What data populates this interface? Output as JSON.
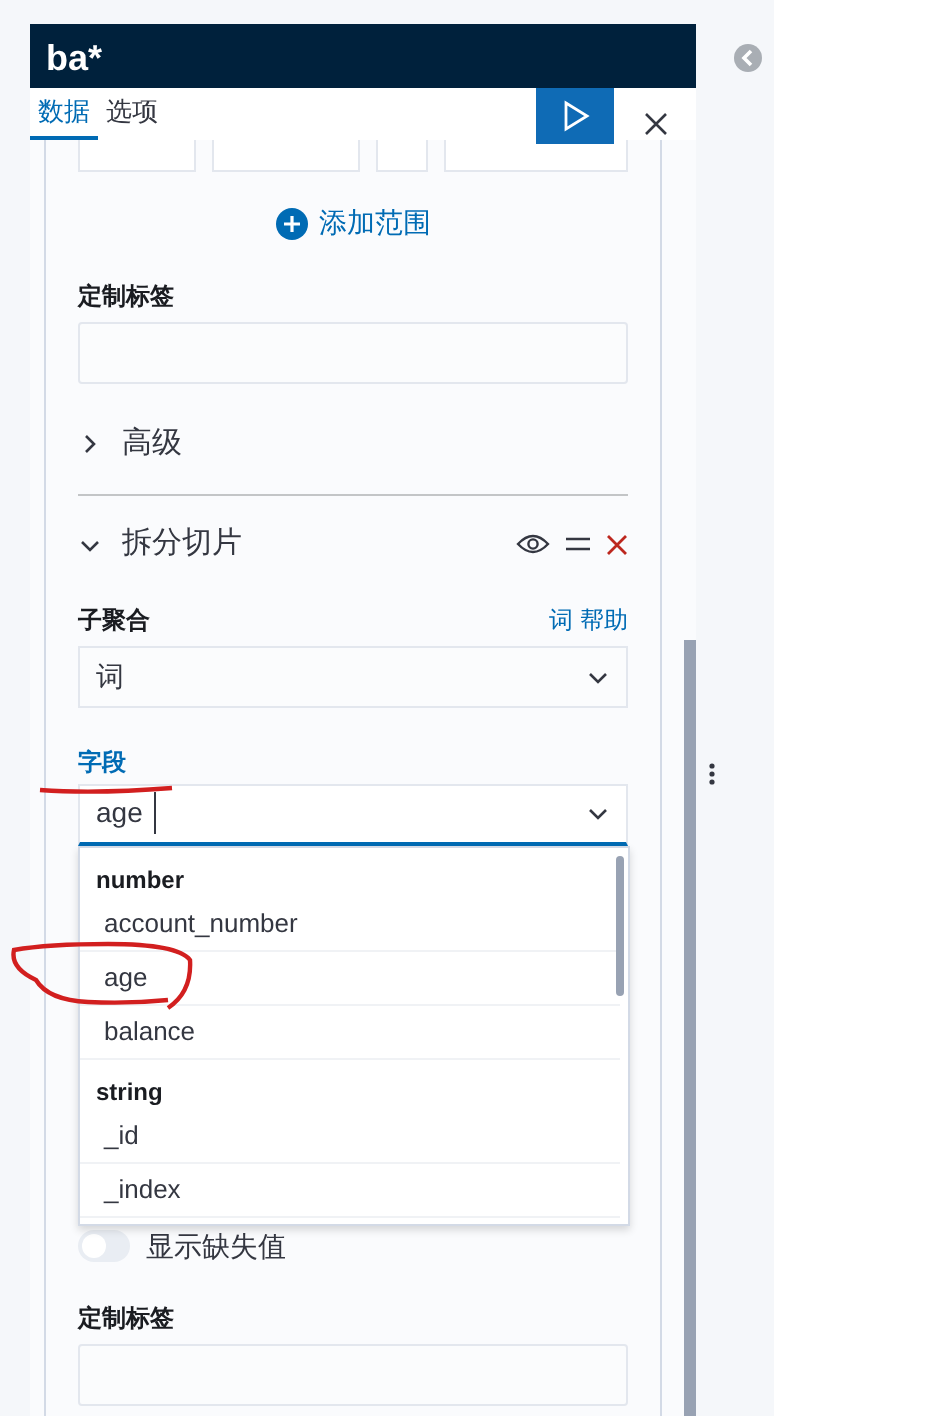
{
  "panel": {
    "title": "ba*",
    "tabs": [
      {
        "label": "数据",
        "selected": true
      },
      {
        "label": "选项",
        "selected": false
      }
    ]
  },
  "range": {
    "add_label": "添加范围"
  },
  "custom_label_top": {
    "label": "定制标签"
  },
  "advanced": {
    "label": "高级",
    "expanded": false
  },
  "split": {
    "label": "拆分切片",
    "expanded": true,
    "sub_agg_label": "子聚合",
    "help_link": "词 帮助",
    "sub_agg_value": "词",
    "field_label": "字段",
    "field_value": "age",
    "options": [
      {
        "kind": "group",
        "label": "number"
      },
      {
        "kind": "option",
        "label": "account_number"
      },
      {
        "kind": "option",
        "label": "age"
      },
      {
        "kind": "option",
        "label": "balance"
      },
      {
        "kind": "group",
        "label": "string"
      },
      {
        "kind": "option",
        "label": "_id"
      },
      {
        "kind": "option",
        "label": "_index"
      }
    ],
    "missing_toggle": {
      "label": "显示缺失值",
      "on": false
    },
    "custom_label": "定制标签"
  }
}
